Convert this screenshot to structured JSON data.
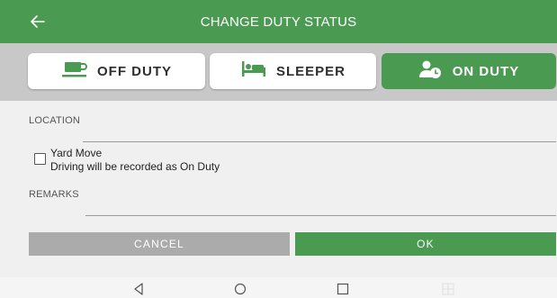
{
  "header": {
    "title": "CHANGE DUTY STATUS",
    "back_icon": "back-arrow-icon",
    "color": "#4a9a52"
  },
  "status_options": [
    {
      "label": "OFF DUTY",
      "icon": "coffee-cup-icon",
      "selected": false
    },
    {
      "label": "SLEEPER",
      "icon": "bed-icon",
      "selected": false
    },
    {
      "label": "ON DUTY",
      "icon": "person-clock-icon",
      "selected": true
    }
  ],
  "form": {
    "location_label": "LOCATION",
    "location_value": "",
    "yard_move": {
      "checked": false,
      "title": "Yard Move",
      "subtitle": "Driving will be recorded as On Duty"
    },
    "remarks_label": "REMARKS",
    "remarks_value": ""
  },
  "actions": {
    "cancel_label": "CANCEL",
    "ok_label": "OK"
  },
  "navbar": {
    "icons": [
      "back-triangle-icon",
      "home-circle-icon",
      "recents-square-icon",
      "grid-icon"
    ]
  }
}
